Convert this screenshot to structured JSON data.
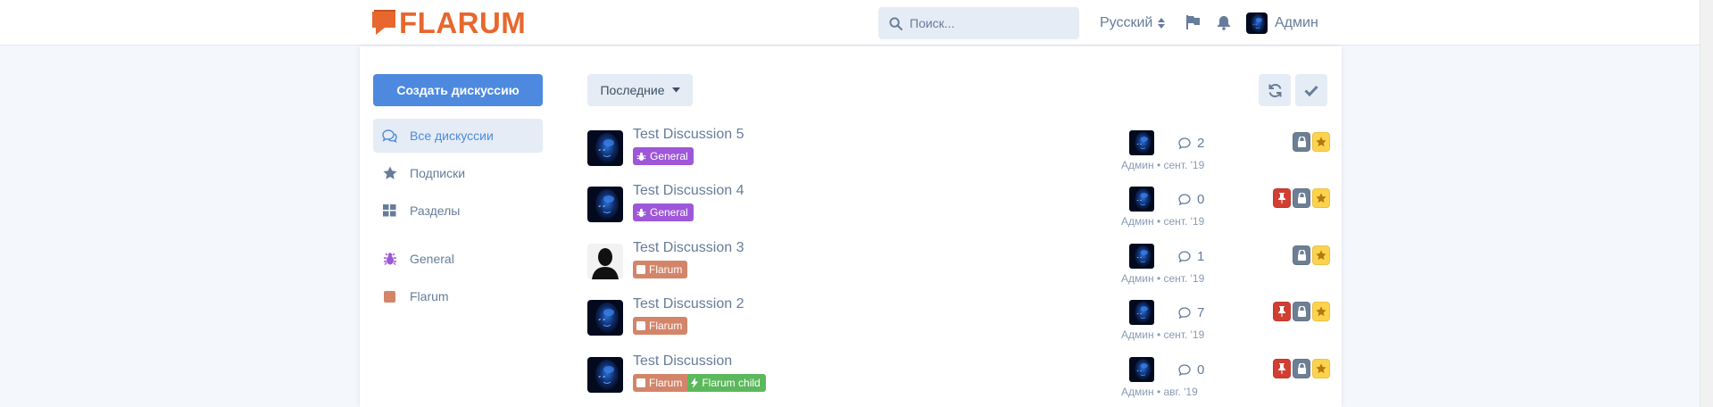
{
  "header": {
    "logo_text": "FLARUM",
    "search_placeholder": "Поиск...",
    "language": "Русский",
    "username": "Админ",
    "brand_color": "#e7672e"
  },
  "sidebar": {
    "start_button": "Создать дискуссию",
    "items": [
      {
        "label": "Все дискуссии",
        "icon": "comments-icon",
        "active": true
      },
      {
        "label": "Подписки",
        "icon": "star-icon",
        "active": false
      },
      {
        "label": "Разделы",
        "icon": "grid-icon",
        "active": false
      },
      {
        "label": "General",
        "icon": "bug-icon",
        "active": false,
        "color": "#9e57d8"
      },
      {
        "label": "Flarum",
        "icon": "square-icon",
        "active": false,
        "color": "#d3856a"
      }
    ]
  },
  "toolbar": {
    "sort_label": "Последние"
  },
  "discussions": [
    {
      "title": "Test Discussion 5",
      "tags": [
        {
          "label": "General",
          "color": "#9e57d8",
          "icon": "bug"
        }
      ],
      "replies": "2",
      "author": "Админ",
      "date": "сент. '19",
      "badges": [
        "lock",
        "star"
      ],
      "avatar": "blue"
    },
    {
      "title": "Test Discussion 4",
      "tags": [
        {
          "label": "General",
          "color": "#9e57d8",
          "icon": "bug"
        }
      ],
      "replies": "0",
      "author": "Админ",
      "date": "сент. '19",
      "badges": [
        "pin",
        "lock",
        "star"
      ],
      "avatar": "blue"
    },
    {
      "title": "Test Discussion 3",
      "tags": [
        {
          "label": "Flarum",
          "color": "#d3856a",
          "icon": "square"
        }
      ],
      "replies": "1",
      "author": "Админ",
      "date": "сент. '19",
      "badges": [
        "lock",
        "star"
      ],
      "avatar": "silhouette"
    },
    {
      "title": "Test Discussion 2",
      "tags": [
        {
          "label": "Flarum",
          "color": "#d3856a",
          "icon": "square"
        }
      ],
      "replies": "7",
      "author": "Админ",
      "date": "сент. '19",
      "badges": [
        "pin",
        "lock",
        "star"
      ],
      "avatar": "blue"
    },
    {
      "title": "Test Discussion",
      "tags": [
        {
          "label": "Flarum",
          "color": "#d3856a",
          "icon": "square"
        },
        {
          "label": "Flarum child",
          "color": "#5cb85c",
          "icon": "bolt"
        }
      ],
      "replies": "0",
      "author": "Админ",
      "date": "авг. '19",
      "badges": [
        "pin",
        "lock",
        "star"
      ],
      "avatar": "blue"
    }
  ],
  "colors": {
    "accent": "#4d8adf",
    "pin": "#d13e32",
    "lock": "#6d7f94",
    "star": "#fdd34e"
  }
}
